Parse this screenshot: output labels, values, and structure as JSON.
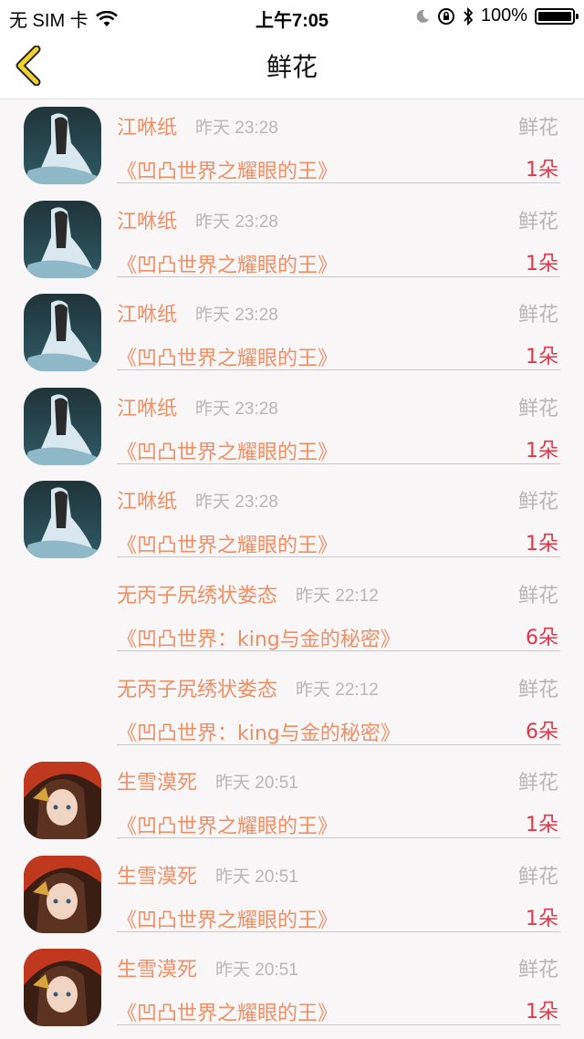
{
  "status": {
    "carrier": "无 SIM 卡",
    "time": "上午7:05",
    "battery": "100%"
  },
  "nav": {
    "title": "鲜花"
  },
  "gifts": [
    {
      "name": "江咻纸",
      "time": "昨天 23:28",
      "type": "鲜花",
      "book": "《凹凸世界之耀眼的王》",
      "count": "1朵",
      "avatar": "avatar-white-robe"
    },
    {
      "name": "江咻纸",
      "time": "昨天 23:28",
      "type": "鲜花",
      "book": "《凹凸世界之耀眼的王》",
      "count": "1朵",
      "avatar": "avatar-white-robe"
    },
    {
      "name": "江咻纸",
      "time": "昨天 23:28",
      "type": "鲜花",
      "book": "《凹凸世界之耀眼的王》",
      "count": "1朵",
      "avatar": "avatar-white-robe"
    },
    {
      "name": "江咻纸",
      "time": "昨天 23:28",
      "type": "鲜花",
      "book": "《凹凸世界之耀眼的王》",
      "count": "1朵",
      "avatar": "avatar-white-robe"
    },
    {
      "name": "江咻纸",
      "time": "昨天 23:28",
      "type": "鲜花",
      "book": "《凹凸世界之耀眼的王》",
      "count": "1朵",
      "avatar": "avatar-white-robe"
    },
    {
      "name": "无丙子尻绣状娄态",
      "time": "昨天 22:12",
      "type": "鲜花",
      "book": "《凹凸世界：king与金的秘密》",
      "count": "6朵",
      "avatar": ""
    },
    {
      "name": "无丙子尻绣状娄态",
      "time": "昨天 22:12",
      "type": "鲜花",
      "book": "《凹凸世界：king与金的秘密》",
      "count": "6朵",
      "avatar": ""
    },
    {
      "name": "生雪漠死",
      "time": "昨天 20:51",
      "type": "鲜花",
      "book": "《凹凸世界之耀眼的王》",
      "count": "1朵",
      "avatar": "avatar-red-hair"
    },
    {
      "name": "生雪漠死",
      "time": "昨天 20:51",
      "type": "鲜花",
      "book": "《凹凸世界之耀眼的王》",
      "count": "1朵",
      "avatar": "avatar-red-hair"
    },
    {
      "name": "生雪漠死",
      "time": "昨天 20:51",
      "type": "鲜花",
      "book": "《凹凸世界之耀眼的王》",
      "count": "1朵",
      "avatar": "avatar-red-hair"
    }
  ],
  "colors": {
    "accent": "#ef8f64",
    "count": "#e0364a",
    "muted": "#b7b7b7",
    "back_icon": "#f3d22e"
  }
}
